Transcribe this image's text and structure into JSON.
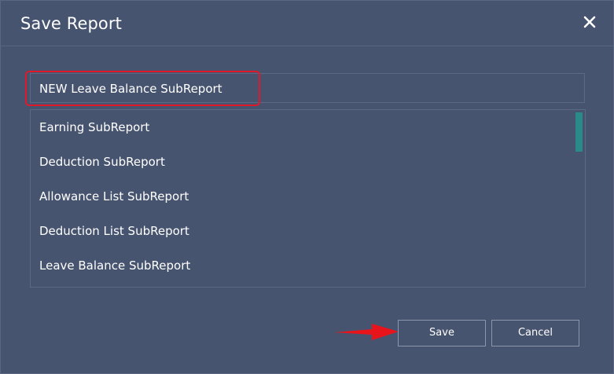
{
  "dialog": {
    "title": "Save Report",
    "close_icon": "close-icon"
  },
  "name_input": {
    "value": "NEW Leave Balance SubReport"
  },
  "report_list": {
    "items": [
      {
        "label": "Earning SubReport"
      },
      {
        "label": "Deduction SubReport"
      },
      {
        "label": "Allowance List SubReport"
      },
      {
        "label": "Deduction List SubReport"
      },
      {
        "label": "Leave Balance SubReport"
      }
    ]
  },
  "buttons": {
    "save_label": "Save",
    "cancel_label": "Cancel"
  },
  "colors": {
    "background": "#475470",
    "highlight": "#e0192a",
    "scrollbar": "#2a8a8a",
    "arrow": "#e8141c"
  }
}
